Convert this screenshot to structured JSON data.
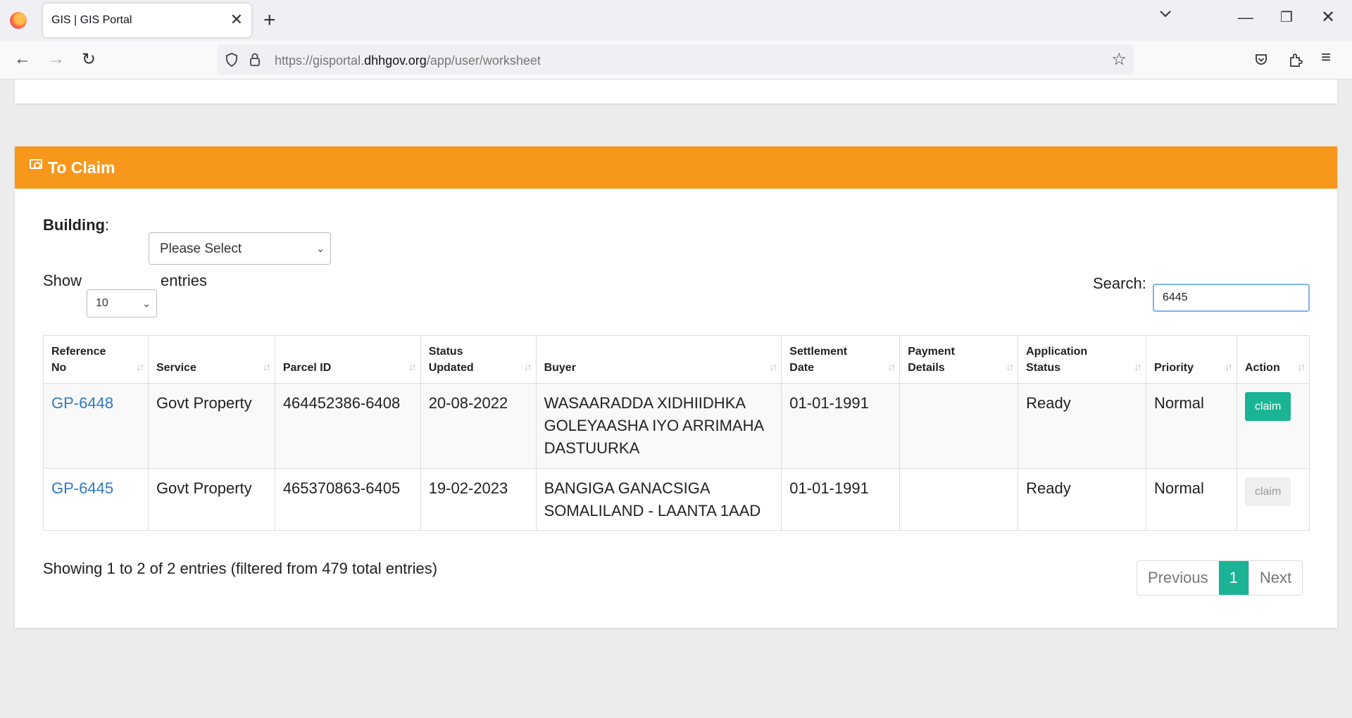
{
  "browser": {
    "tab_title": "GIS | GIS Portal",
    "url_prefix": "https://gisportal.",
    "url_domain": "dhhgov.org",
    "url_path": "/app/user/worksheet"
  },
  "panel": {
    "title": "To Claim",
    "building_label": "Building",
    "building_colon": ":",
    "building_selected": "Please Select",
    "show_label": "Show",
    "entries_selected": "10",
    "entries_label": "entries",
    "search_label": "Search:",
    "search_value": "6445"
  },
  "table": {
    "columns": [
      {
        "line1": "Reference",
        "line2": "No"
      },
      {
        "line1": "",
        "line2": "Service"
      },
      {
        "line1": "",
        "line2": "Parcel ID"
      },
      {
        "line1": "Status",
        "line2": "Updated"
      },
      {
        "line1": "",
        "line2": "Buyer"
      },
      {
        "line1": "Settlement",
        "line2": "Date"
      },
      {
        "line1": "Payment",
        "line2": "Details"
      },
      {
        "line1": "Application",
        "line2": "Status"
      },
      {
        "line1": "",
        "line2": "Priority"
      },
      {
        "line1": "",
        "line2": "Action"
      }
    ],
    "rows": [
      {
        "ref": "GP-6448",
        "service": "Govt Property",
        "parcel": "464452386-6408",
        "status_updated": "20-08-2022",
        "buyer": "WASAARADDA XIDHIIDHKA GOLEYAASHA IYO ARRIMAHA DASTUURKA",
        "settlement": "01-01-1991",
        "payment": "",
        "app_status": "Ready",
        "priority": "Normal",
        "action": "claim"
      },
      {
        "ref": "GP-6445",
        "service": "Govt Property",
        "parcel": "465370863-6405",
        "status_updated": "19-02-2023",
        "buyer": "BANGIGA GANACSIGA SOMALILAND - LAANTA 1AAD",
        "settlement": "01-01-1991",
        "payment": "",
        "app_status": "Ready",
        "priority": "Normal",
        "action": "claim"
      }
    ]
  },
  "footer": {
    "info": "Showing 1 to 2 of 2 entries (filtered from 479 total entries)",
    "previous": "Previous",
    "page": "1",
    "next": "Next"
  }
}
